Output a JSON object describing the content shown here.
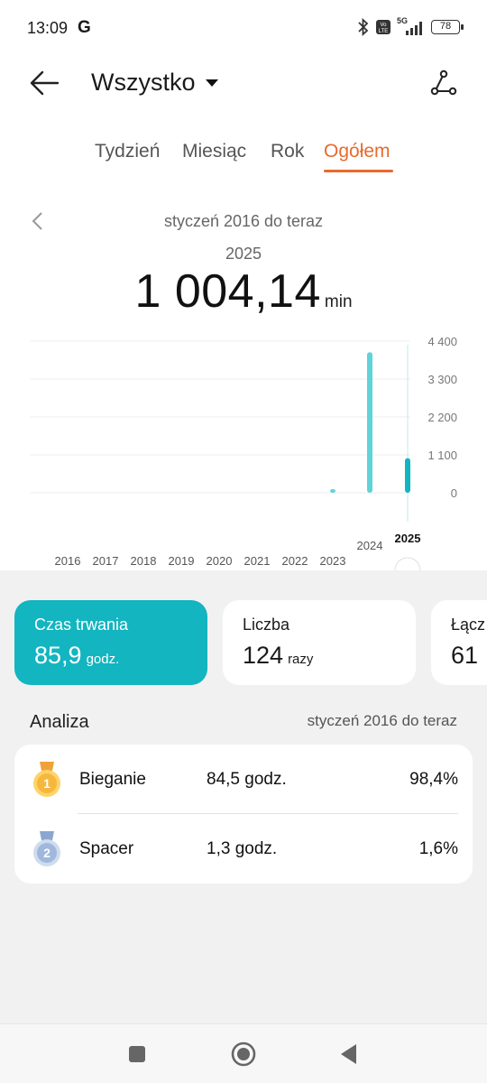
{
  "status_bar": {
    "time": "13:09",
    "carrier_icon": "G",
    "signal_label": "5G",
    "battery": "78"
  },
  "header": {
    "title": "Wszystko"
  },
  "tabs": [
    {
      "label": "Tydzień",
      "active": false
    },
    {
      "label": "Miesiąc",
      "active": false
    },
    {
      "label": "Rok",
      "active": false
    },
    {
      "label": "Ogółem",
      "active": true
    }
  ],
  "summary": {
    "range": "styczeń 2016 do teraz",
    "selected_year": "2025",
    "value": "1 004,14",
    "unit": "min"
  },
  "chart_data": {
    "type": "bar",
    "categories": [
      "2016",
      "2017",
      "2018",
      "2019",
      "2020",
      "2021",
      "2022",
      "2023",
      "2024",
      "2025"
    ],
    "values": [
      0,
      0,
      0,
      0,
      0,
      0,
      0,
      60,
      4080,
      1004.14
    ],
    "y_ticks": [
      "4 400",
      "3 300",
      "2 200",
      "1 100",
      "0"
    ],
    "ylim": [
      0,
      4400
    ],
    "selected_category": "2025",
    "bar_color": "#5fd3d9",
    "selected_color": "#12b5c0"
  },
  "cards": [
    {
      "label": "Czas trwania",
      "value": "85,9",
      "unit": "godz.",
      "active": true
    },
    {
      "label": "Liczba",
      "value": "124",
      "unit": "razy",
      "active": false
    },
    {
      "label": "Łącz",
      "value": "61",
      "unit": "",
      "active": false
    }
  ],
  "analysis": {
    "title": "Analiza",
    "range": "styczeń 2016 do teraz",
    "rows": [
      {
        "rank": "1",
        "name": "Bieganie",
        "hours": "84,5 godz.",
        "percent": "98,4%",
        "medal": "gold-medal-icon"
      },
      {
        "rank": "2",
        "name": "Spacer",
        "hours": "1,3 godz.",
        "percent": "1,6%",
        "medal": "silver-medal-icon"
      }
    ]
  },
  "colors": {
    "accent": "#e86a2e",
    "teal": "#12b5c0"
  }
}
